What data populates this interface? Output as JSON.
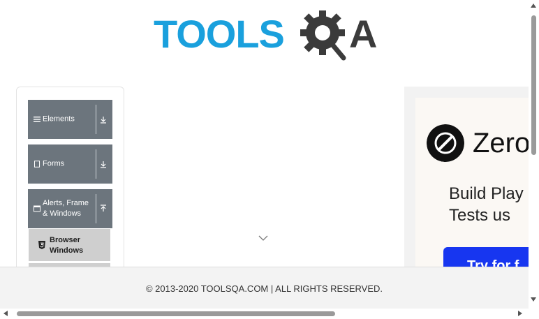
{
  "header": {
    "logo_text": "TOOLS",
    "logo_suffix": "A"
  },
  "nav": {
    "groups": [
      {
        "label": "Elements",
        "icon": "list-icon",
        "expanded": false
      },
      {
        "label": "Forms",
        "icon": "form-icon",
        "expanded": false
      },
      {
        "label": "Alerts, Frame & Windows",
        "icon": "window-icon",
        "expanded": true
      }
    ],
    "sub_items": [
      {
        "label": "Browser Windows",
        "icon": "html5-icon"
      }
    ]
  },
  "ad": {
    "brand": "Zero",
    "headline": "Build Play\nTests us",
    "cta": "Try for f"
  },
  "footer": {
    "copyright": "© 2013-2020 TOOLSQA.COM | ALL RIGHTS RESERVED."
  },
  "colors": {
    "brand_blue": "#1aa0dd",
    "nav_group_bg": "#6c757d",
    "sub_item_bg": "#cfcfcf",
    "ad_cta": "#1736f0"
  }
}
